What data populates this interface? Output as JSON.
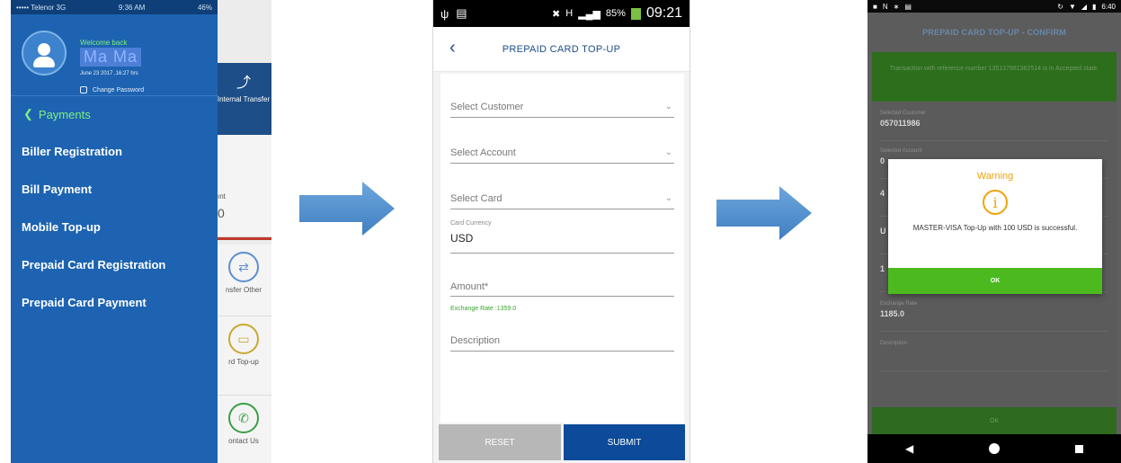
{
  "screen1": {
    "status": {
      "carrier": "••••• Telenor  3G",
      "time": "9:36 AM",
      "battery": "46%"
    },
    "profile": {
      "welcome": "Welcome back",
      "name": "Ma Ma",
      "last_login": "June 23 2017 ,16:27 hrs",
      "change_password": "Change Password"
    },
    "menu": {
      "back_label": "Payments",
      "items": [
        {
          "label": "Biller Registration"
        },
        {
          "label": "Bill Payment"
        },
        {
          "label": "Mobile Top-up"
        },
        {
          "label": "Prepaid Card Registration"
        },
        {
          "label": "Prepaid Card Payment"
        }
      ]
    },
    "background": {
      "internal_transfer": "Internal Transfer",
      "transfer_other": "nsfer Other",
      "card_topup": "rd Top-up",
      "contact_us": "ontact Us",
      "partial_amount": "0",
      "partial_label": "ınt"
    }
  },
  "screen2": {
    "status": {
      "battery": "85%",
      "time": "09:21",
      "network": "H"
    },
    "header": {
      "title": "PREPAID CARD TOP-UP",
      "back_icon": "chevron-left-icon"
    },
    "fields": {
      "customer_placeholder": "Select Customer",
      "account_placeholder": "Select Account",
      "card_placeholder": "Select Card",
      "currency_label": "Card Currency",
      "currency_value": "USD",
      "amount_placeholder": "Amount*",
      "exchange_rate": "Exchange Rate :1359.0",
      "description_placeholder": "Description"
    },
    "buttons": {
      "reset": "RESET",
      "submit": "SUBMIT"
    },
    "colors": {
      "primary": "#0d4a99",
      "reset": "#b7b7b7",
      "rate": "#3aa32e"
    }
  },
  "screen3": {
    "status": {
      "time": "6:40"
    },
    "header": {
      "title": "PREPAID CARD TOP-UP - CONFIRM"
    },
    "banner": "Transaction with reference number 135137981362514 is in Accepted state.",
    "rows": {
      "customer_key": "Selected Customer",
      "customer_value": "057011986",
      "account_key": "Selected Account",
      "account_value": "0",
      "row3_value": "4",
      "row4_value": "U",
      "row5_value": "1",
      "exchange_key": "Exchange Rate",
      "exchange_value": "1185.0",
      "description_key": "Description"
    },
    "ok_bar": "OK",
    "dialog": {
      "title": "Warning",
      "icon": "info-icon",
      "message": "MASTER-VISA Top-Up with 100 USD is successful.",
      "ok": "OK"
    },
    "colors": {
      "warning": "#f0a30a",
      "ok": "#4cba1f"
    }
  }
}
